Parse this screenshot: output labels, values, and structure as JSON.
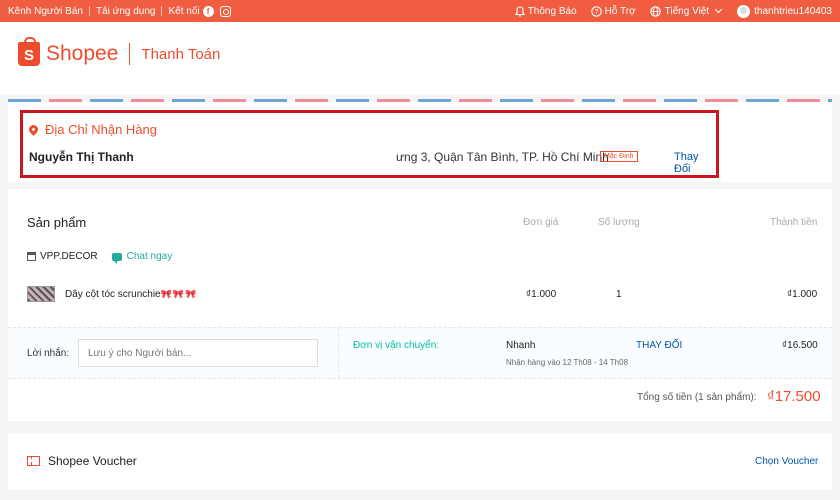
{
  "topbar": {
    "seller_channel": "Kênh Người Bán",
    "download_app": "Tải ứng dụng",
    "connect": "Kết nối",
    "facebook_glyph": "f",
    "notifications": "Thông Báo",
    "help": "Hỗ Trợ",
    "language": "Tiếng Việt",
    "username": "thanhtrieu140403",
    "icons": [
      "facebook-icon",
      "instagram-icon",
      "bell-icon",
      "help-icon",
      "globe-icon",
      "chevron-down-icon",
      "avatar"
    ]
  },
  "header": {
    "logo_letter": "S",
    "brand": "Shopee",
    "title": "Thanh Toán"
  },
  "address": {
    "title": "Địa Chỉ Nhận Hàng",
    "name": "Nguyễn Thị Thanh",
    "text": "ưng 3, Quận Tân Bình, TP. Hồ Chí Minh",
    "default_badge": "Mặc Định",
    "change": "Thay Đổi"
  },
  "products": {
    "section_title": "Sản phẩm",
    "columns": {
      "unit_price": "Đơn giá",
      "quantity": "Số lượng",
      "subtotal": "Thành tiền"
    },
    "shop_name": "VPP.DECOR",
    "chat_now": "Chat ngay",
    "items": [
      {
        "name": "Dây cột tóc scrunchie",
        "decor": "🎀🎀🎀",
        "unit_price": "₫1.000",
        "quantity": "1",
        "subtotal": "₫1.000"
      }
    ]
  },
  "message": {
    "label": "Lời nhắn:",
    "placeholder": "Lưu ý cho Người bán..."
  },
  "shipping": {
    "label": "Đơn vị vận chuyển:",
    "method": "Nhanh",
    "eta": "Nhận hàng vào 12 Th08 - 14 Th08",
    "change": "THAY ĐỔI",
    "fee": "₫16.500"
  },
  "total": {
    "label": "Tổng số tiền (1 sản phẩm):",
    "value": "₫17.500"
  },
  "voucher": {
    "title": "Shopee Voucher",
    "action": "Chọn Voucher"
  },
  "colors": {
    "brand": "#ee4d2d",
    "topbar": "#f05d40",
    "highlight_box": "#c8171f",
    "link": "#0055aa",
    "teal": "#26aa99"
  }
}
